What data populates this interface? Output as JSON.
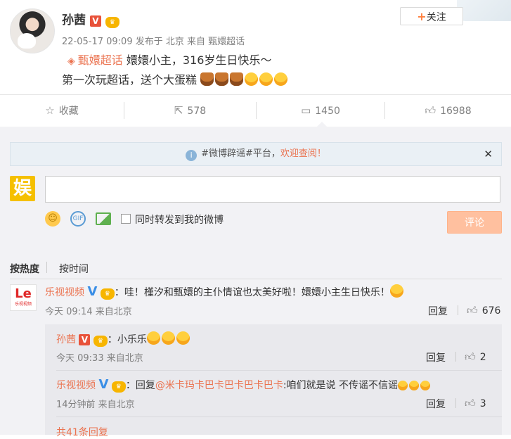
{
  "post": {
    "author": "孙茜",
    "meta": "22-05-17 09:09 发布于 北京 来自 甄嬛超话",
    "topic": "甄嬛超话",
    "line1_text": " 嬛嬛小主，316岁生日快乐～",
    "line2_text": "第一次玩超话，送个大蛋糕",
    "follow_label": "关注"
  },
  "actions": {
    "favorite": "收藏",
    "repost": "578",
    "comment": "1450",
    "like": "16988"
  },
  "notice": {
    "prefix": "#微博辟谣#平台，",
    "link": "欢迎查阅！"
  },
  "composer": {
    "input_value": "",
    "repost_label": "同时转发到我的微博",
    "submit_label": "评论"
  },
  "sort": {
    "hot": "按热度",
    "time": "按时间"
  },
  "comments": [
    {
      "author": "乐视视频",
      "avatar_text": "Le",
      "avatar_sub": "乐视视频",
      "text": "：哇！槿汐和甄嬛的主仆情谊也太美好啦！嬛嬛小主生日快乐！",
      "time": "今天 09:14 来自北京",
      "reply_label": "回复",
      "likes": "676",
      "replies": [
        {
          "author": "孙茜",
          "text": "：小乐乐",
          "time": "今天 09:33 来自北京",
          "reply_label": "回复",
          "likes": "2"
        },
        {
          "author": "乐视视频",
          "text_prefix": "：回复",
          "mention": "@米卡玛卡巴卡巴卡巴卡巴卡",
          "text_suffix": ":咱们就是说 不传谣不信谣",
          "time": "14分钟前 来自北京",
          "reply_label": "回复",
          "likes": "3"
        }
      ],
      "more_label": "共41条回复"
    }
  ],
  "colors": {
    "accent": "#eb7350",
    "background_comment": "#f2f2f5",
    "submit_disabled": "#ffc09f"
  }
}
